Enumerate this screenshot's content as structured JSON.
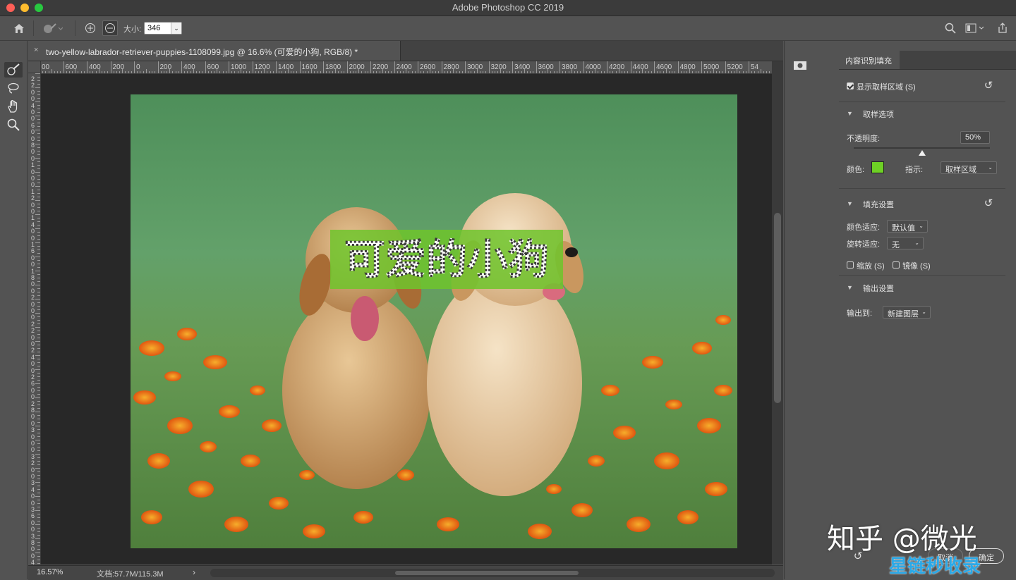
{
  "window": {
    "title": "Adobe Photoshop CC 2019",
    "colors": {
      "close": "#fe5f57",
      "minimize": "#febc2e",
      "zoom": "#28c840"
    }
  },
  "options_bar": {
    "size_label": "大小:",
    "size_value": "346"
  },
  "toolbar": {
    "tools": [
      "brush-icon",
      "lasso-icon",
      "hand-icon",
      "zoom-icon"
    ]
  },
  "document": {
    "tab_title": "two-yellow-labrador-retriever-puppies-1108099.jpg @ 16.6% (可爱的小狗, RGB/8) *",
    "close_glyph": "×",
    "overlay_text": "可爱的小狗"
  },
  "ruler": {
    "top_labels": [
      "00",
      "600",
      "400",
      "200",
      "0",
      "200",
      "400",
      "600",
      "1000",
      "1200",
      "1400",
      "1600",
      "1800",
      "2000",
      "2200",
      "2400",
      "2600",
      "2800",
      "3000",
      "3200",
      "3400",
      "3600",
      "3800",
      "4000",
      "4200",
      "4400",
      "4600",
      "4800",
      "5000",
      "5200",
      "54"
    ],
    "left_labels": [
      "2",
      "2",
      "0",
      "0",
      "4",
      "0",
      "0",
      "6",
      "0",
      "0",
      "8",
      "0",
      "0",
      "1",
      "0",
      "0",
      "0",
      "1",
      "2",
      "0",
      "0",
      "1",
      "4",
      "0",
      "0",
      "1",
      "6",
      "0",
      "0",
      "1",
      "8",
      "0",
      "0",
      "2",
      "0",
      "0",
      "0",
      "2",
      "2",
      "0",
      "0",
      "2",
      "4",
      "0",
      "0",
      "2",
      "6",
      "0",
      "0",
      "2",
      "8",
      "0",
      "0",
      "3",
      "0",
      "0",
      "0",
      "3",
      "2",
      "0",
      "0",
      "3",
      "4",
      "0",
      "0",
      "3",
      "6",
      "0",
      "0",
      "3",
      "8",
      "0",
      "0",
      "4"
    ]
  },
  "status": {
    "zoom": "16.57%",
    "doc": "文档:57.7M/115.3M",
    "arrow": "›"
  },
  "panel": {
    "tab": "内容识别填充",
    "show_sampling": "显示取样区域 (S)",
    "sampling_section": "取样选项",
    "opacity_label": "不透明度:",
    "opacity_value": "50%",
    "opacity": 0.5,
    "color_label": "颜色:",
    "color_swatch": "#6ed025",
    "indicate_label": "指示:",
    "indicate_value": "取样区域",
    "fill_section": "填充设置",
    "color_adapt_label": "颜色适应:",
    "color_adapt_value": "默认值",
    "rotate_label": "旋转适应:",
    "rotate_value": "无",
    "scale_label": "缩放 (S)",
    "mirror_label": "镜像 (S)",
    "output_section": "输出设置",
    "output_label": "输出到:",
    "output_value": "新建图层",
    "cancel": "取消",
    "ok": "确定"
  },
  "watermark": {
    "line1": "知乎 @微光",
    "line2": "星链秒收录"
  }
}
